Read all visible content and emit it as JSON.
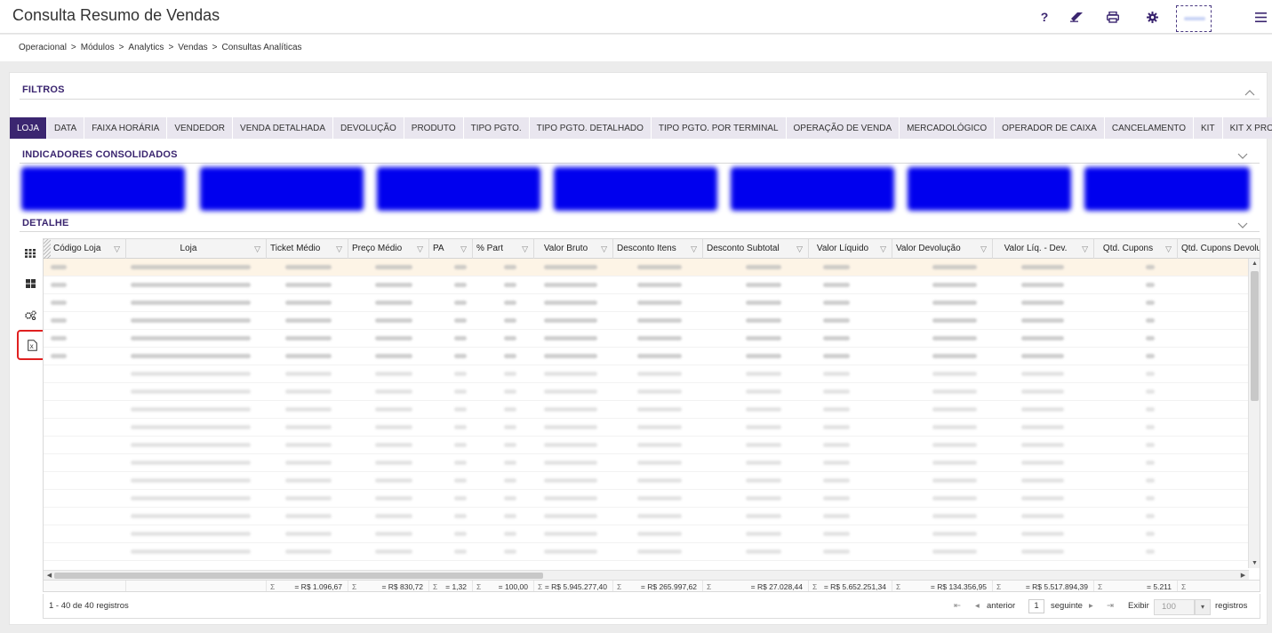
{
  "header": {
    "title": "Consulta Resumo de Vendas",
    "icons": [
      "help-icon",
      "eraser-icon",
      "print-icon",
      "settings-icon",
      "user-avatar",
      "menu-icon"
    ],
    "help_glyph": "?"
  },
  "breadcrumb": [
    "Operacional",
    "Módulos",
    "Analytics",
    "Vendas",
    "Consultas Analíticas"
  ],
  "breadcrumb_sep": ">",
  "sections": {
    "filters": "FILTROS",
    "indicators": "INDICADORES CONSOLIDADOS",
    "detail": "DETALHE"
  },
  "tabs": [
    {
      "label": "LOJA",
      "active": true
    },
    {
      "label": "DATA"
    },
    {
      "label": "FAIXA HORÁRIA"
    },
    {
      "label": "VENDEDOR"
    },
    {
      "label": "VENDA DETALHADA"
    },
    {
      "label": "DEVOLUÇÃO"
    },
    {
      "label": "PRODUTO"
    },
    {
      "label": "TIPO PGTO."
    },
    {
      "label": "TIPO PGTO. DETALHADO"
    },
    {
      "label": "TIPO PGTO. POR TERMINAL"
    },
    {
      "label": "OPERAÇÃO DE VENDA"
    },
    {
      "label": "MERCADOLÓGICO"
    },
    {
      "label": "OPERADOR DE CAIXA"
    },
    {
      "label": "CANCELAMENTO"
    },
    {
      "label": "KIT"
    },
    {
      "label": "KIT X PRODUTO"
    }
  ],
  "toolbar": [
    "grid-view-icon",
    "tile-view-icon",
    "settings-cogs-icon",
    "excel-export-icon"
  ],
  "grid": {
    "columns": [
      {
        "label": "Código Loja"
      },
      {
        "label": "Loja"
      },
      {
        "label": "Ticket Médio"
      },
      {
        "label": "Preço Médio"
      },
      {
        "label": "PA"
      },
      {
        "label": "% Part"
      },
      {
        "label": "Valor Bruto"
      },
      {
        "label": "Desconto Itens"
      },
      {
        "label": "Desconto Subtotal"
      },
      {
        "label": "Valor Líquido"
      },
      {
        "label": "Valor Devolução"
      },
      {
        "label": "Valor Líq. - Dev."
      },
      {
        "label": "Qtd. Cupons"
      },
      {
        "label": "Qtd. Cupons Devolução"
      }
    ],
    "sum_symbol": "Σ",
    "totals": [
      {
        "col": 2,
        "value": "= R$ 1.096,67"
      },
      {
        "col": 3,
        "value": "= R$ 830,72"
      },
      {
        "col": 4,
        "value": "= 1,32"
      },
      {
        "col": 5,
        "value": "= 100,00"
      },
      {
        "col": 6,
        "value": "= R$ 5.945.277,40"
      },
      {
        "col": 7,
        "value": "= R$ 265.997,62"
      },
      {
        "col": 8,
        "value": "= R$ 27.028,44"
      },
      {
        "col": 9,
        "value": "= R$ 5.652.251,34"
      },
      {
        "col": 10,
        "value": "= R$ 134.356,95"
      },
      {
        "col": 11,
        "value": "= R$ 5.517.894,39"
      },
      {
        "col": 12,
        "value": "= 5.211"
      },
      {
        "col": 13,
        "value": ""
      }
    ]
  },
  "pager": {
    "info": "1 - 40 de 40 registros",
    "prev": "anterior",
    "page": "1",
    "next": "seguinte",
    "show": "Exibir",
    "page_size": "100",
    "suffix": "registros"
  }
}
